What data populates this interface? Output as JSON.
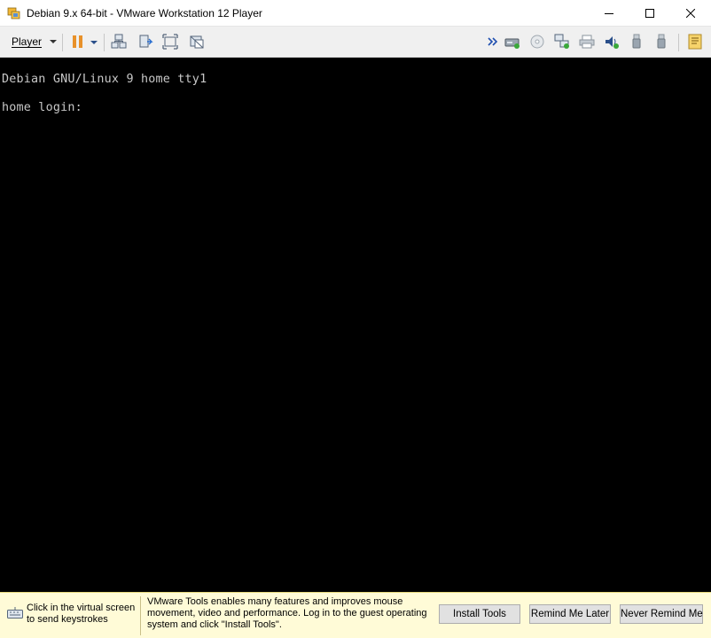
{
  "window": {
    "title": "Debian 9.x 64-bit - VMware Workstation 12 Player"
  },
  "toolbar": {
    "player_label": "Player",
    "left_icons": [
      "pause-icon",
      "pause-dropdown-icon",
      "send-ctrl-alt-del-icon",
      "removable-devices-icon",
      "fullscreen-icon",
      "unity-icon"
    ],
    "right_icons": [
      "expand-devices-icon",
      "hard-disk-icon",
      "cd-dvd-icon",
      "network-adapter-icon",
      "printer-icon",
      "sound-card-icon",
      "usb-device-icon",
      "usb-device-2-icon",
      "message-log-icon"
    ]
  },
  "console": {
    "line1": "Debian GNU/Linux 9 home tty1",
    "line2": "home login:"
  },
  "notification": {
    "hint": "Click in the virtual screen to send keystrokes",
    "message": "VMware Tools enables many features and improves mouse movement, video and performance. Log in to the guest operating system and click \"Install Tools\".",
    "install_label": "Install Tools",
    "remind_label": "Remind Me Later",
    "never_label": "Never Remind Me"
  },
  "colors": {
    "console_bg": "#000000",
    "console_text": "#c8c8c8",
    "notification_bg": "#fffbd7",
    "pause_accent": "#e8912a"
  }
}
